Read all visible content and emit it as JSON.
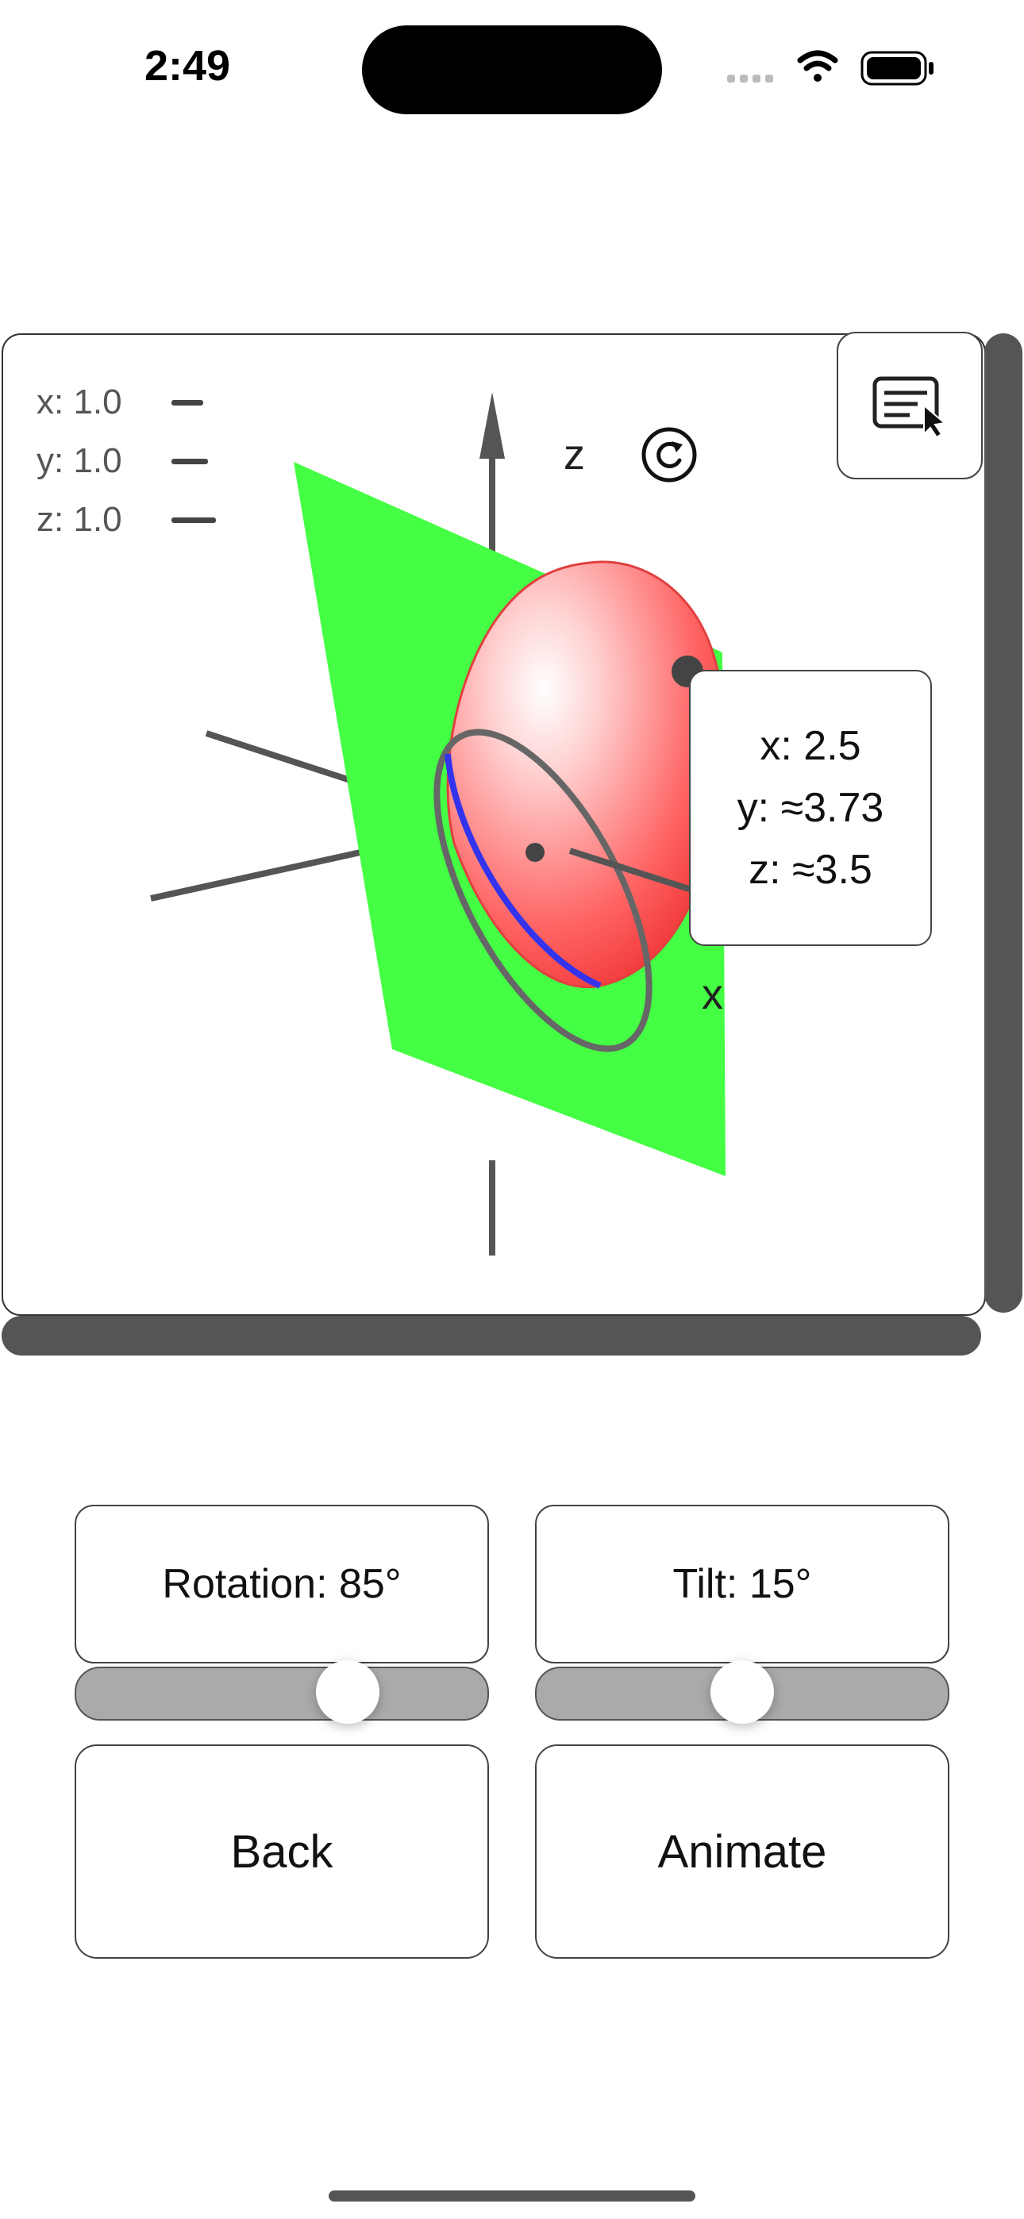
{
  "status_bar": {
    "time": "2:49"
  },
  "axis_legend": [
    {
      "label": "x: 1.0"
    },
    {
      "label": "y: 1.0"
    },
    {
      "label": "z: 1.0"
    }
  ],
  "scene": {
    "z_axis_label": "z",
    "x_axis_label": "x",
    "colors": {
      "ellipsoid": "#ff5555",
      "plane": "#44ff44",
      "curve": "#3333ee",
      "axes": "#555555"
    }
  },
  "tooltip": {
    "x": "x: 2.5",
    "y": "y: ≈3.73",
    "z": "z: ≈3.5"
  },
  "controls": {
    "rotation_label": "Rotation: 85°",
    "rotation_value": 0.69,
    "tilt_label": "Tilt: 15°",
    "tilt_value": 0.5
  },
  "buttons": {
    "back_label": "Back",
    "animate_label": "Animate"
  },
  "icons": {
    "reset": "reset-rotation-icon",
    "overlay": "text-cursor-icon",
    "wifi": "wifi-icon",
    "battery": "battery-icon",
    "signal": "cellular-signal-icon"
  }
}
